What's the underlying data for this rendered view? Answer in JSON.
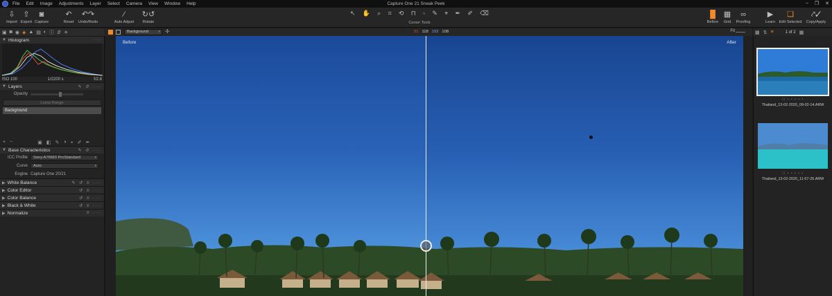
{
  "menubar": {
    "items": [
      "File",
      "Edit",
      "Image",
      "Adjustments",
      "Layer",
      "Select",
      "Camera",
      "View",
      "Window",
      "Help"
    ],
    "window_title": "Capture One 21 Sneak Peek"
  },
  "toolbar": {
    "import": "Import",
    "export": "Export",
    "capture": "Capture",
    "reset": "Reset",
    "undo_redo": "Undo/Redo",
    "auto_adjust": "Auto Adjust",
    "rotate": "Rotate",
    "cursor_tools": "Cursor Tools",
    "before": "Before",
    "grid": "Grid",
    "proofing": "Proofing",
    "learn": "Learn",
    "edit_selected": "Edit Selected",
    "copy_apply": "Copy/Apply"
  },
  "histogram": {
    "title": "Histogram",
    "iso": "ISO 100",
    "shutter": "1/2200 s",
    "aperture": "f/2.8"
  },
  "layers": {
    "title": "Layers",
    "opacity_label": "Opacity",
    "luma_range": "Luma Range",
    "background_layer": "Background"
  },
  "base_characteristics": {
    "title": "Base Characteristics",
    "icc_label": "ICC Profile",
    "icc_value": "Sony A7RM3 ProStandard",
    "curve_label": "Curve",
    "curve_value": "Auto",
    "engine_label": "Engine",
    "engine_value": "Capture One 20/21"
  },
  "tools": [
    "White Balance",
    "Color Editor",
    "Color Balance",
    "Black & White",
    "Normalize"
  ],
  "viewer": {
    "layer_select": "Background",
    "rgb": [
      "51",
      "118",
      "193",
      "108"
    ],
    "fit": "Fit",
    "before_label": "Before",
    "after_label": "After"
  },
  "browser": {
    "count": "1 of 2",
    "thumbs": [
      {
        "name": "Thailand_13-02-2020_09-02-14.ARW",
        "stars": "☐ • • • • •"
      },
      {
        "name": "Thailand_13-02-2020_11-57-26.ARW",
        "stars": "☐ • • • • •"
      }
    ]
  },
  "colors": {
    "accent": "#f08a2a",
    "sky_top": "#1b4a9a",
    "sky_bottom": "#69a9e6"
  }
}
